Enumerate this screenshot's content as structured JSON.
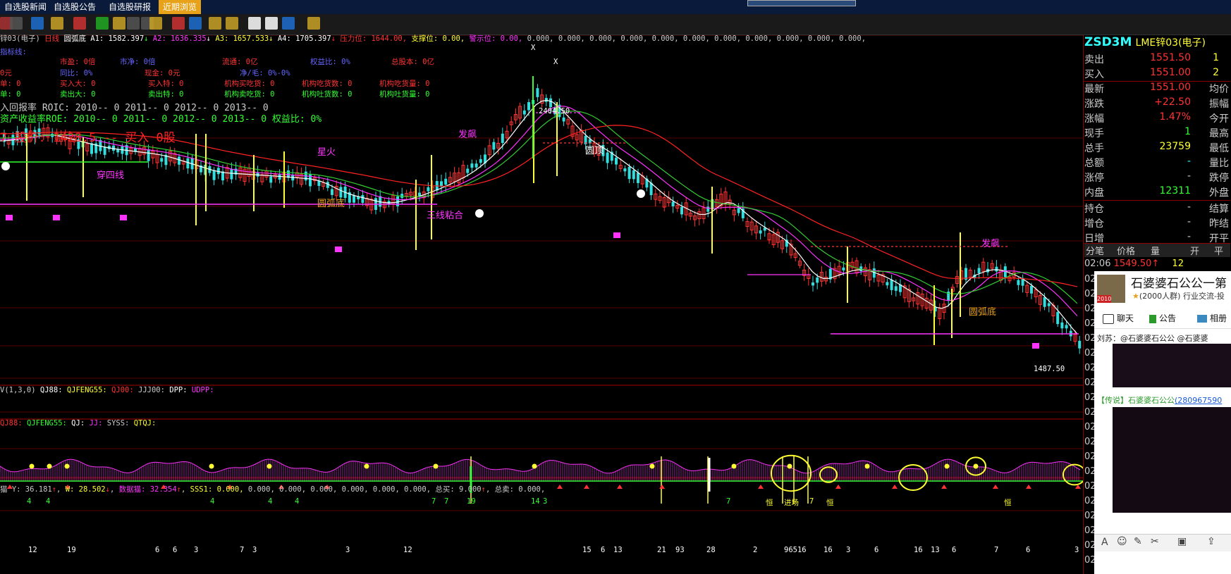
{
  "menu": {
    "tabs": [
      "自选股新闻",
      "自选股公告",
      "自选股研报",
      "近期浏览"
    ],
    "active_index": 3
  },
  "title_row": {
    "name": "锌03(电子)",
    "period": "日线",
    "pattern": "圆弧底",
    "a1": "A1: 1582.397",
    "a2": "A2: 1636.335",
    "a3": "A3: 1657.533",
    "a4": "A4: 1705.397",
    "pressure": "压力位: 1644.00,",
    "support": "支撑位: 0.00,",
    "warning": "警示位: 0.00,",
    "tail": "0.000, 0.000, 0.000, 0.000, 0.000, 0.000, 0.000, 0.000, 0.000, 0.000, 0.000,"
  },
  "info_lines": {
    "l1": "指标线:",
    "f1": [
      "市盈: 0倍",
      "市净: 0倍",
      "流通: 0亿",
      "权益比: 0%",
      "总股本: 0亿"
    ],
    "f2": [
      "0元",
      "同比: 0%",
      "现金: 0元",
      "净/毛: 0%-0%"
    ],
    "f3": [
      "单: 0",
      "买入大: 0",
      "买入特: 0",
      "机构买吃货: 0",
      "机构吃货数: 0",
      "机构吃货量: 0"
    ],
    "f4": [
      "单: 0",
      "卖出大: 0",
      "卖出特: 0",
      "机构卖吃货: 0",
      "机构吐货数: 0",
      "机构吐货量: 0"
    ],
    "roic": "入回报率 ROIC: 2010-- 0    2011-- 0    2012-- 0    2013-- 0",
    "roe": "资产收益率ROE: 2010-- 0    2011-- 0    2012-- 0    2013-- 0    权益比: 0%",
    "buy": "7 股价: 1428.5  -- 买入 0股"
  },
  "chart_labels": {
    "high": "2404.50",
    "low": "1487.50",
    "labels": [
      "星火",
      "穿四线",
      "圆弧底",
      "三线粘合",
      "发飙",
      "圆顶",
      "发飙",
      "圆弧底"
    ],
    "xmarks": [
      "X",
      "X"
    ]
  },
  "sub1": [
    "V(1,3,0)",
    "QJ88:",
    "QJFENG55:",
    "QJ00:",
    "JJJ00:",
    "DPP:",
    "UDPP:"
  ],
  "sub2": [
    "QJ88:",
    "QJFENG55:",
    "QJ:",
    "JJ:",
    "SYSS:",
    "QTQJ:"
  ],
  "sub3": [
    "猫 Y: 36.181",
    "W: 28.502",
    "数据猫: 32.354",
    "SSS1: 0.000,",
    "0.000, 0.000, 0.000, 0.000, 0.000, 0.000,",
    "总买: 9.000",
    "总卖: 0.000,"
  ],
  "bottom_nums": [
    "12",
    "19",
    "6",
    "6",
    "3",
    "7",
    "3",
    "3",
    "12",
    "15",
    "6",
    "13",
    "21",
    "93",
    "28",
    "2",
    "96516",
    "16",
    "3",
    "6",
    "16",
    "13",
    "6",
    "7",
    "6",
    "3"
  ],
  "sub3_top": [
    "4",
    "4",
    "4",
    "4",
    "4",
    "7",
    "7",
    "19",
    "14",
    "3",
    "7",
    "恒",
    "进场",
    "恒",
    "7",
    "恒"
  ],
  "quote": {
    "code": "ZSD3M",
    "name": "LME锌03(电子)",
    "sell_label": "卖出",
    "sell_price": "1551.50",
    "sell_vol": "1",
    "buy_label": "买入",
    "buy_price": "1551.00",
    "buy_vol": "2",
    "rows": [
      {
        "l": "最新",
        "v": "1551.00",
        "r": "均价",
        "c": "#ff3333"
      },
      {
        "l": "涨跌",
        "v": "+22.50",
        "r": "振幅",
        "c": "#ff3333"
      },
      {
        "l": "涨幅",
        "v": "1.47%",
        "r": "今开",
        "c": "#ff3333"
      },
      {
        "l": "现手",
        "v": "1",
        "r": "最高",
        "c": "#33ff33"
      },
      {
        "l": "总手",
        "v": "23759",
        "r": "最低",
        "c": "#ffff33"
      },
      {
        "l": "总额",
        "v": "-",
        "r": "量比",
        "c": "#33ffff"
      },
      {
        "l": "涨停",
        "v": "-",
        "r": "跌停",
        "c": "#cccccc"
      },
      {
        "l": "内盘",
        "v": "12311",
        "r": "外盘",
        "c": "#33ff33"
      },
      {
        "l": "持仓",
        "v": "-",
        "r": "结算",
        "c": "#cccccc"
      },
      {
        "l": "增仓",
        "v": "-",
        "r": "昨结",
        "c": "#cccccc"
      },
      {
        "l": "日增",
        "v": "-",
        "r": "开平",
        "c": "#cccccc"
      }
    ],
    "tick_tabs": [
      "分笔",
      "价格",
      "量",
      "开",
      "平"
    ],
    "tick_time": "02:06",
    "tick_price": "1549.50",
    "tick_vol": "12",
    "tick_times": [
      "02",
      "02",
      "02",
      "02",
      "02",
      "02",
      "02",
      "02",
      "02",
      "02",
      "02",
      "02",
      "02",
      "02",
      "02",
      "02",
      "02",
      "02",
      "02",
      "02"
    ]
  },
  "chat": {
    "group_name": "石婆婆石公公一第",
    "group_info": "(2000人群) 行业交流-投",
    "badge": "2010",
    "actions": [
      "聊天",
      "公告",
      "相册"
    ],
    "msg1": "刘苏：@石婆婆石公公 @石婆婆",
    "msg2_prefix": "【传说】石婆婆石公公",
    "msg2_link": "(280967590"
  },
  "colors": {
    "ma_white": "#ffffff",
    "ma_magenta": "#ff33ff",
    "ma_green": "#33cc33",
    "ma_red": "#ff2222",
    "up": "#ff3333",
    "down": "#33dddd",
    "menu_active": "#e8a21a"
  }
}
